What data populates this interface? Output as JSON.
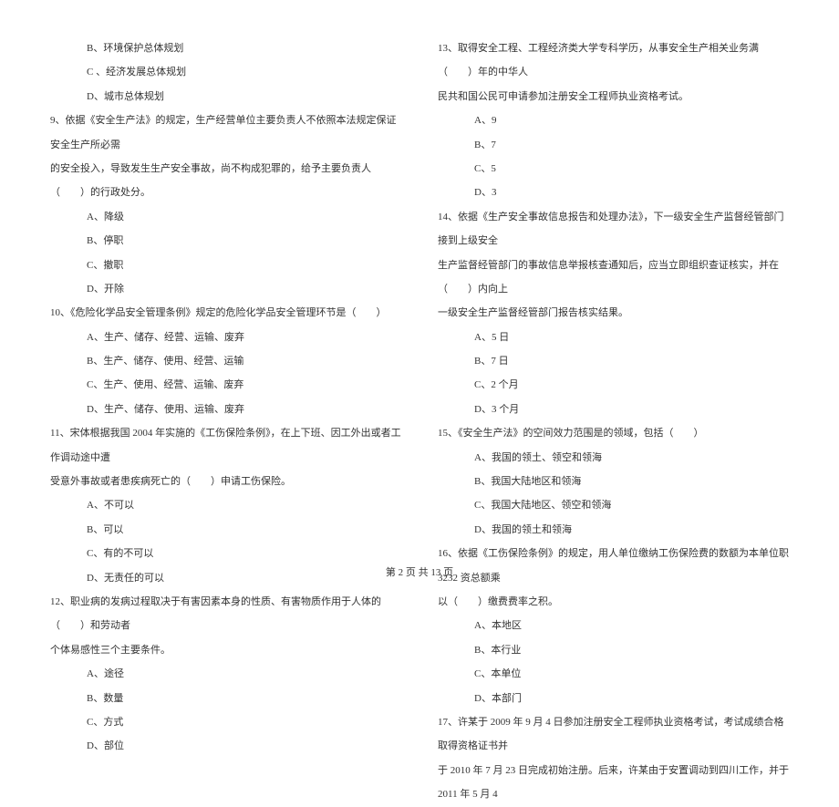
{
  "left": {
    "q8_optB": "B、环境保护总体规划",
    "q8_optC": "C 、经济发展总体规划",
    "q8_optD": "D、城市总体规划",
    "q9_text": "9、依据《安全生产法》的规定，生产经营单位主要负责人不依照本法规定保证安全生产所必需",
    "q9_text2": "的安全投入，导致发生生产安全事故，尚不构成犯罪的，给予主要负责人（　　）的行政处分。",
    "q9_optA": "A、降级",
    "q9_optB": "B、停职",
    "q9_optC": "C、撤职",
    "q9_optD": "D、开除",
    "q10_text": "10、《危险化学品安全管理条例》规定的危险化学品安全管理环节是（　　）",
    "q10_optA": "A、生产、储存、经营、运输、废弃",
    "q10_optB": "B、生产、储存、使用、经营、运输",
    "q10_optC": "C、生产、使用、经营、运输、废弃",
    "q10_optD": "D、生产、储存、使用、运输、废弃",
    "q11_text": "11、宋体根据我国 2004 年实施的《工伤保险条例》，在上下班、因工外出或者工作调动途中遭",
    "q11_text2": "受意外事故或者患疾病死亡的（　　）申请工伤保险。",
    "q11_optA": "A、不可以",
    "q11_optB": "B、可以",
    "q11_optC": "C、有的不可以",
    "q11_optD": "D、无责任的可以",
    "q12_text": "12、职业病的发病过程取决于有害因素本身的性质、有害物质作用于人体的（　　）和劳动者",
    "q12_text2": "个体易感性三个主要条件。",
    "q12_optA": "A、途径",
    "q12_optB": "B、数量",
    "q12_optC": "C、方式",
    "q12_optD": "D、部位"
  },
  "right": {
    "q13_text": "13、取得安全工程、工程经济类大学专科学历，从事安全生产相关业务满（　　）年的中华人",
    "q13_text2": "民共和国公民可申请参加注册安全工程师执业资格考试。",
    "q13_optA": "A、9",
    "q13_optB": "B、7",
    "q13_optC": "C、5",
    "q13_optD": "D、3",
    "q14_text": "14、依据《生产安全事故信息报告和处理办法》，下一级安全生产监督经管部门接到上级安全",
    "q14_text2": "生产监督经管部门的事故信息举报核查通知后，应当立即组织查证核实，并在（　　）内向上",
    "q14_text3": "一级安全生产监督经管部门报告核实结果。",
    "q14_optA": "A、5 日",
    "q14_optB": "B、7 日",
    "q14_optC": "C、2 个月",
    "q14_optD": "D、3 个月",
    "q15_text": "15、《安全生产法》的空间效力范围是的领域，包括（　　）",
    "q15_optA": "A、我国的领土、领空和领海",
    "q15_optB": "B、我国大陆地区和领海",
    "q15_optC": "C、我国大陆地区、领空和领海",
    "q15_optD": "D、我国的领土和领海",
    "q16_text": "16、依据《工伤保险条例》的规定，用人单位缴纳工伤保险费的数额为本单位职 3232 资总额乘",
    "q16_text2": "以（　　）缴费费率之积。",
    "q16_optA": "A、本地区",
    "q16_optB": "B、本行业",
    "q16_optC": "C、本单位",
    "q16_optD": "D、本部门",
    "q17_text": "17、许某于 2009 年 9 月 4 日参加注册安全工程师执业资格考试，考试成绩合格取得资格证书并",
    "q17_text2": "于 2010 年 7 月 23 日完成初始注册。后来，许某由于安置调动到四川工作，并于 2011 年 5 月 4"
  },
  "footer": "第 2 页 共 13 页"
}
